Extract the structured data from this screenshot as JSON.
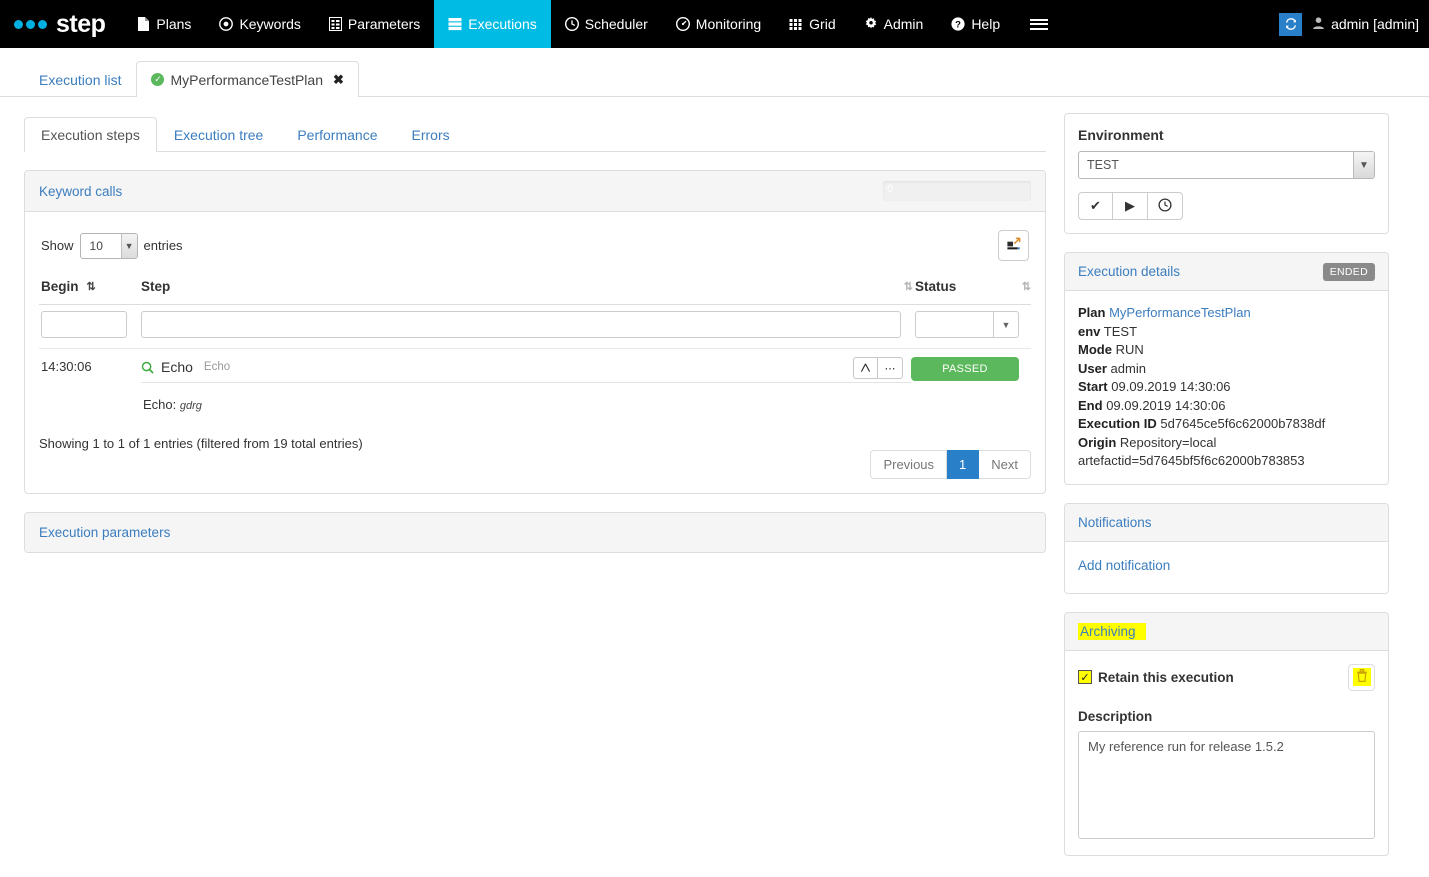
{
  "navbar": {
    "brand": "step",
    "items": [
      {
        "label": "Plans",
        "icon": "file-icon",
        "active": false
      },
      {
        "label": "Keywords",
        "icon": "target-icon",
        "active": false
      },
      {
        "label": "Parameters",
        "icon": "list-icon",
        "active": false
      },
      {
        "label": "Executions",
        "icon": "server-icon",
        "active": true
      },
      {
        "label": "Scheduler",
        "icon": "clock-icon",
        "active": false
      },
      {
        "label": "Monitoring",
        "icon": "dashboard-icon",
        "active": false
      },
      {
        "label": "Grid",
        "icon": "grid-icon",
        "active": false
      },
      {
        "label": "Admin",
        "icon": "gear-icon",
        "active": false
      },
      {
        "label": "Help",
        "icon": "question-circle-icon",
        "active": false
      }
    ],
    "menu_icon": "hamburger-icon",
    "refresh_icon": "refresh-icon",
    "user": "admin [admin]",
    "user_icon": "user-icon",
    "accent_color": "#00bce4",
    "refresh_color": "#2a7fc9"
  },
  "toptabs": {
    "execution_list": "Execution list",
    "open_tab": "MyPerformanceTestPlan",
    "open_tab_status_icon": "check-circle-icon",
    "close_icon": "close-icon"
  },
  "subtabs": [
    {
      "label": "Execution steps",
      "active": true
    },
    {
      "label": "Execution tree",
      "active": false
    },
    {
      "label": "Performance",
      "active": false
    },
    {
      "label": "Errors",
      "active": false
    }
  ],
  "keyword_calls": {
    "title": "Keyword calls",
    "progress_value": "0",
    "show_label": "Show",
    "entries_label": "entries",
    "page_size": "10",
    "export_icon": "export-icon",
    "columns": [
      {
        "label": "Begin",
        "sort_icon": "sort-asc-icon",
        "sorted": true
      },
      {
        "label": "Step",
        "sort_icon": "sort-icon",
        "sorted": false
      },
      {
        "label": "Status",
        "sort_icon": "sort-icon",
        "sorted": false
      }
    ],
    "filters": {
      "begin": "",
      "step": "",
      "status": "",
      "status_caret_icon": "caret-down-icon"
    },
    "rows": [
      {
        "begin": "14:30:06",
        "step_icon": "magnifier-icon",
        "step_name": "Echo",
        "step_sub": "Echo",
        "step_detail_label": "Echo:",
        "step_detail_value": "gdrg",
        "action_tree_icon": "tree-icon",
        "action_more_icon": "ellipsis-icon",
        "status": "PASSED",
        "status_color": "#5cb85c"
      }
    ],
    "showing_text": "Showing 1 to 1 of 1 entries (filtered from 19 total entries)",
    "pagination": {
      "previous": "Previous",
      "current": "1",
      "next": "Next"
    }
  },
  "execution_parameters": {
    "title": "Execution parameters"
  },
  "environment": {
    "panel_label": "Environment",
    "selected": "TEST",
    "buttons": [
      {
        "icon": "check-icon",
        "name": "validate-button"
      },
      {
        "icon": "play-icon",
        "name": "execute-button"
      },
      {
        "icon": "clock-icon",
        "name": "schedule-button"
      }
    ]
  },
  "execution_details": {
    "title": "Execution details",
    "badge": "ENDED",
    "fields": [
      {
        "label": "Plan",
        "value": "MyPerformanceTestPlan",
        "link": true
      },
      {
        "label": "env",
        "value": "TEST",
        "link": false
      },
      {
        "label": "Mode",
        "value": "RUN",
        "link": false
      },
      {
        "label": "User",
        "value": "admin",
        "link": false
      },
      {
        "label": "Start",
        "value": "09.09.2019 14:30:06",
        "link": false
      },
      {
        "label": "End",
        "value": "09.09.2019 14:30:06",
        "link": false
      },
      {
        "label": "Execution ID",
        "value": "5d7645ce5f6c62000b7838df",
        "link": false
      },
      {
        "label": "Origin",
        "value": "Repository=local",
        "link": false
      }
    ],
    "origin_second_line": "artefactid=5d7645bf5f6c62000b783853"
  },
  "notifications": {
    "title": "Notifications",
    "add_link": "Add notification"
  },
  "archiving": {
    "title": "Archiving",
    "title_highlighted": true,
    "retain_label": "Retain this execution",
    "retain_checked": true,
    "delete_icon": "trash-icon",
    "description_label": "Description",
    "description_value": "My reference run for release 1.5.2",
    "highlight_color": "#ffff00"
  }
}
